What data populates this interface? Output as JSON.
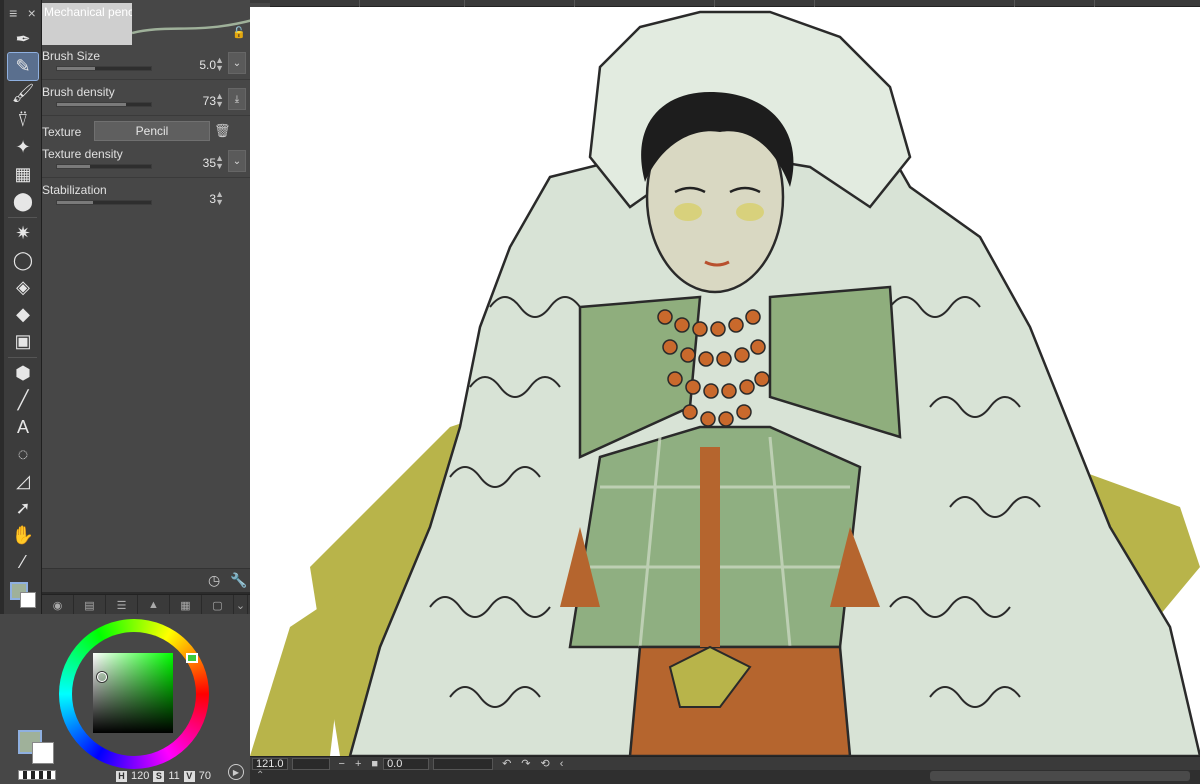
{
  "tool_property": {
    "brush_name": "Mechanical pencil",
    "rows": [
      {
        "label": "Brush Size",
        "value": "5.0",
        "fill": 0.4
      },
      {
        "label": "Brush density",
        "value": "73",
        "fill": 0.73
      },
      {
        "label": "Texture density",
        "value": "35",
        "fill": 0.35
      },
      {
        "label": "Stabilization",
        "value": "3",
        "fill": 0.38
      }
    ],
    "texture_label": "Texture",
    "texture_value": "Pencil"
  },
  "color": {
    "main": "#9fb19a",
    "sub": "#ffffff",
    "hsv": {
      "h_key": "H",
      "h": "120",
      "s_key": "S",
      "s": "11",
      "v_key": "V",
      "v": "70"
    }
  },
  "status": {
    "zoom": "121.0",
    "angle": "0.0"
  }
}
